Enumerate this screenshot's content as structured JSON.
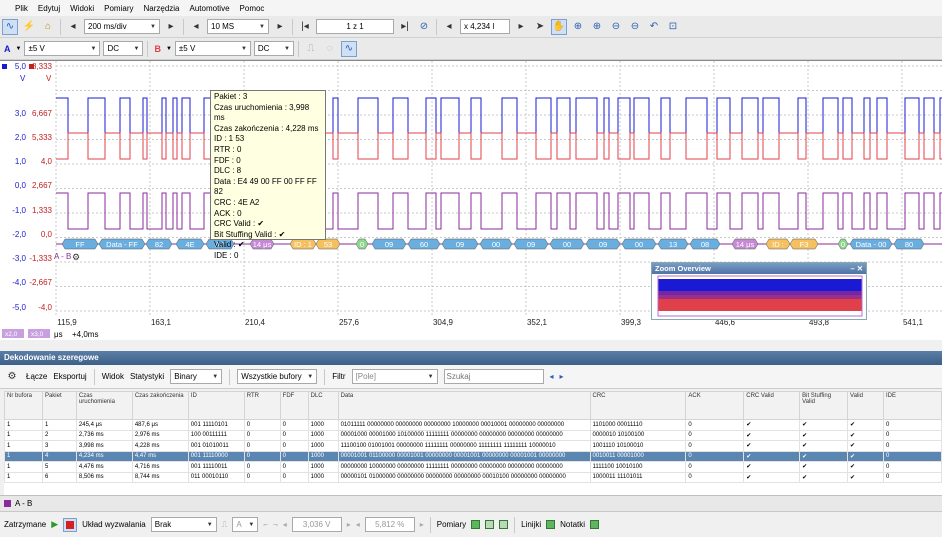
{
  "menu": [
    "Plik",
    "Edytuj",
    "Widoki",
    "Pomiary",
    "Narzędzia",
    "Automotive",
    "Pomoc"
  ],
  "toolbar1": {
    "timebase": "200 ms/div",
    "samples": "10 MS",
    "zoom": "1 z 1",
    "zoom_x": "x 4,234 l"
  },
  "toolbar2": {
    "chA_label": "A",
    "chA_range": "±5 V",
    "chA_coupling": "DC",
    "chB_label": "B",
    "chB_range": "±5 V",
    "chB_coupling": "DC"
  },
  "scope": {
    "y_top_a": "5,0",
    "y_top_b": "8,333",
    "unit_a": "V",
    "unit_b": "V",
    "y_left": [
      "3,0",
      "2,0",
      "1,0",
      "0,0",
      "-1,0",
      "-2,0",
      "-3,0",
      "-4,0",
      "-5,0"
    ],
    "y_right": [
      "6,667",
      "5,333",
      "4,0",
      "2,667",
      "1,333",
      "0,0",
      "-1,333",
      "-2,667",
      "-4,0"
    ],
    "x_ticks": [
      "115,9",
      "163,1",
      "210,4",
      "257,6",
      "304,9",
      "352,1",
      "399,3",
      "446,6",
      "493,8",
      "541,1"
    ],
    "x_unit": "μs",
    "x_offset": "+4,0ms",
    "chip_a": "x2,0",
    "chip_b": "x3,0",
    "series_label": "A - B",
    "packets": [
      {
        "x": 62,
        "w": 36,
        "t": "FF",
        "c": "#6aaee0"
      },
      {
        "x": 99,
        "w": 46,
        "t": "Data - FF",
        "c": "#6aaee0"
      },
      {
        "x": 146,
        "w": 26,
        "t": "82",
        "c": "#6aaee0"
      },
      {
        "x": 176,
        "w": 28,
        "t": "4E",
        "c": "#6aaee0"
      },
      {
        "x": 206,
        "w": 28,
        "t": "A2",
        "c": "#6aaee0"
      },
      {
        "x": 250,
        "w": 24,
        "t": "14 μs",
        "c": "#c48bd4"
      },
      {
        "x": 290,
        "w": 26,
        "t": "ID : 1",
        "c": "#f5c060"
      },
      {
        "x": 316,
        "w": 24,
        "t": "53",
        "c": "#f5c060"
      },
      {
        "x": 356,
        "w": 12,
        "t": "0",
        "c": "#8fd88f"
      },
      {
        "x": 372,
        "w": 34,
        "t": "09",
        "c": "#6aaee0"
      },
      {
        "x": 408,
        "w": 32,
        "t": "60",
        "c": "#6aaee0"
      },
      {
        "x": 442,
        "w": 36,
        "t": "09",
        "c": "#6aaee0"
      },
      {
        "x": 480,
        "w": 32,
        "t": "00",
        "c": "#6aaee0"
      },
      {
        "x": 514,
        "w": 34,
        "t": "09",
        "c": "#6aaee0"
      },
      {
        "x": 550,
        "w": 34,
        "t": "00",
        "c": "#6aaee0"
      },
      {
        "x": 586,
        "w": 34,
        "t": "09",
        "c": "#6aaee0"
      },
      {
        "x": 622,
        "w": 34,
        "t": "00",
        "c": "#6aaee0"
      },
      {
        "x": 658,
        "w": 30,
        "t": "13",
        "c": "#6aaee0"
      },
      {
        "x": 690,
        "w": 30,
        "t": "08",
        "c": "#6aaee0"
      },
      {
        "x": 732,
        "w": 26,
        "t": "14 μs",
        "c": "#c48bd4"
      },
      {
        "x": 766,
        "w": 24,
        "t": "ID :",
        "c": "#f5c060"
      },
      {
        "x": 790,
        "w": 28,
        "t": "F3",
        "c": "#f5c060"
      },
      {
        "x": 838,
        "w": 10,
        "t": "0",
        "c": "#8fd88f"
      },
      {
        "x": 850,
        "w": 42,
        "t": "Data - 00",
        "c": "#6aaee0"
      },
      {
        "x": 894,
        "w": 30,
        "t": "80",
        "c": "#6aaee0"
      }
    ],
    "zoom_title": "Zoom Overview"
  },
  "tooltip": [
    "Pakiet : 3",
    "Czas uruchomienia : 3,998 ms",
    "Czas zakończenia : 4,228 ms",
    "ID : 1 53",
    "RTR : 0",
    "FDF : 0",
    "DLC : 8",
    "Data : E4 49 00 FF 00 FF FF 82",
    "CRC : 4E A2",
    "ACK : 0",
    "CRC Valid : ✔",
    "Bit Stuffing Valid : ✔",
    "Valid : ✔",
    "IDE : 0"
  ],
  "panel": {
    "title": "Dekodowanie szeregowe",
    "btns": [
      "Łącze",
      "Eksportuj",
      "Widok",
      "Statystyki"
    ],
    "fmt": "Binary",
    "buffers": "Wszystkie bufory",
    "filter": "Filtr",
    "field": "[Pole]",
    "search": "Szukaj"
  },
  "columns": [
    "Nr bufora",
    "Pakiet",
    "Czas uruchomienia",
    "Czas zakończenia",
    "ID",
    "RTR",
    "FDF",
    "DLC",
    "Data",
    "CRC",
    "ACK",
    "CRC Valid",
    "Bit Stuffing Valid",
    "Valid",
    "IDE"
  ],
  "rows": [
    [
      "1",
      "1",
      "245,4 μs",
      "487,6 μs",
      "001 11110101",
      "0",
      "0",
      "1000",
      "01011111 00000000 00000000 00000000 10000000 00010001 00000000 00000000",
      "1101000 00011110",
      "0",
      "✔",
      "✔",
      "✔",
      "0"
    ],
    [
      "1",
      "2",
      "2,736 ms",
      "2,976 ms",
      "100 00111111",
      "0",
      "0",
      "1000",
      "00001000 00001000 10100000 11111111 00000000 00000000 00000000 00000000",
      "0000010 10100100",
      "0",
      "✔",
      "✔",
      "✔",
      "0"
    ],
    [
      "1",
      "3",
      "3,998 ms",
      "4,228 ms",
      "001 01010011",
      "0",
      "0",
      "1000",
      "11100100 01001001 00000000 11111111 00000000 11111111 11111111 10000010",
      "1001110 10100010",
      "0",
      "✔",
      "✔",
      "✔",
      "0"
    ],
    [
      "1",
      "4",
      "4,234 ms",
      "4,47 ms",
      "001 11110000",
      "0",
      "0",
      "1000",
      "00001001 01100000 00001001 00000000 00001001 00000000 00001001 00000000",
      "0010011 00001000",
      "0",
      "✔",
      "✔",
      "✔",
      "0"
    ],
    [
      "1",
      "5",
      "4,476 ms",
      "4,716 ms",
      "001 11110011",
      "0",
      "0",
      "1000",
      "00000000 10000000 00000000 11111111 00000000 00000000 00000000 00000000",
      "1111100 10010100",
      "0",
      "✔",
      "✔",
      "✔",
      "0"
    ],
    [
      "1",
      "6",
      "8,506 ms",
      "8,744 ms",
      "011 00010110",
      "0",
      "0",
      "1000",
      "00000101 01000000 00000000 00000000 00000000 00010100 00000000 00000000",
      "1000011 11101011",
      "0",
      "✔",
      "✔",
      "✔",
      "0"
    ]
  ],
  "tab": "A - B",
  "status": {
    "stopped": "Zatrzymane",
    "trigger": "Układ wyzwalania",
    "trig_mode": "Brak",
    "trig_ch": "A",
    "level": "3,036 V",
    "pct": "5,812 %",
    "measure": "Pomiary",
    "rulers": "Linijki",
    "notes": "Notatki"
  },
  "colors": {
    "chA": "#1a1ad4",
    "chB": "#e0404a",
    "math": "#8a2b9a",
    "select": "#5b86b1"
  }
}
